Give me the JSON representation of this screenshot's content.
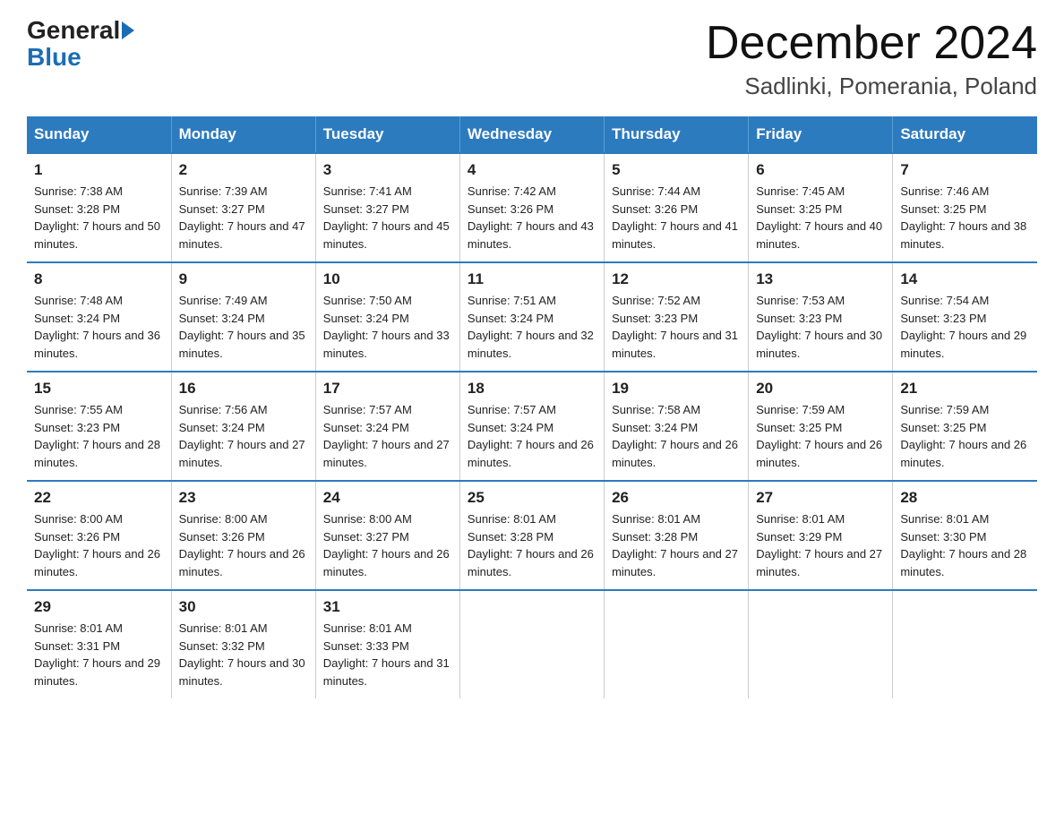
{
  "header": {
    "logo_general": "General",
    "logo_blue": "Blue",
    "month": "December 2024",
    "location": "Sadlinki, Pomerania, Poland"
  },
  "days_of_week": [
    "Sunday",
    "Monday",
    "Tuesday",
    "Wednesday",
    "Thursday",
    "Friday",
    "Saturday"
  ],
  "weeks": [
    [
      {
        "day": "1",
        "sunrise": "7:38 AM",
        "sunset": "3:28 PM",
        "daylight": "7 hours and 50 minutes."
      },
      {
        "day": "2",
        "sunrise": "7:39 AM",
        "sunset": "3:27 PM",
        "daylight": "7 hours and 47 minutes."
      },
      {
        "day": "3",
        "sunrise": "7:41 AM",
        "sunset": "3:27 PM",
        "daylight": "7 hours and 45 minutes."
      },
      {
        "day": "4",
        "sunrise": "7:42 AM",
        "sunset": "3:26 PM",
        "daylight": "7 hours and 43 minutes."
      },
      {
        "day": "5",
        "sunrise": "7:44 AM",
        "sunset": "3:26 PM",
        "daylight": "7 hours and 41 minutes."
      },
      {
        "day": "6",
        "sunrise": "7:45 AM",
        "sunset": "3:25 PM",
        "daylight": "7 hours and 40 minutes."
      },
      {
        "day": "7",
        "sunrise": "7:46 AM",
        "sunset": "3:25 PM",
        "daylight": "7 hours and 38 minutes."
      }
    ],
    [
      {
        "day": "8",
        "sunrise": "7:48 AM",
        "sunset": "3:24 PM",
        "daylight": "7 hours and 36 minutes."
      },
      {
        "day": "9",
        "sunrise": "7:49 AM",
        "sunset": "3:24 PM",
        "daylight": "7 hours and 35 minutes."
      },
      {
        "day": "10",
        "sunrise": "7:50 AM",
        "sunset": "3:24 PM",
        "daylight": "7 hours and 33 minutes."
      },
      {
        "day": "11",
        "sunrise": "7:51 AM",
        "sunset": "3:24 PM",
        "daylight": "7 hours and 32 minutes."
      },
      {
        "day": "12",
        "sunrise": "7:52 AM",
        "sunset": "3:23 PM",
        "daylight": "7 hours and 31 minutes."
      },
      {
        "day": "13",
        "sunrise": "7:53 AM",
        "sunset": "3:23 PM",
        "daylight": "7 hours and 30 minutes."
      },
      {
        "day": "14",
        "sunrise": "7:54 AM",
        "sunset": "3:23 PM",
        "daylight": "7 hours and 29 minutes."
      }
    ],
    [
      {
        "day": "15",
        "sunrise": "7:55 AM",
        "sunset": "3:23 PM",
        "daylight": "7 hours and 28 minutes."
      },
      {
        "day": "16",
        "sunrise": "7:56 AM",
        "sunset": "3:24 PM",
        "daylight": "7 hours and 27 minutes."
      },
      {
        "day": "17",
        "sunrise": "7:57 AM",
        "sunset": "3:24 PM",
        "daylight": "7 hours and 27 minutes."
      },
      {
        "day": "18",
        "sunrise": "7:57 AM",
        "sunset": "3:24 PM",
        "daylight": "7 hours and 26 minutes."
      },
      {
        "day": "19",
        "sunrise": "7:58 AM",
        "sunset": "3:24 PM",
        "daylight": "7 hours and 26 minutes."
      },
      {
        "day": "20",
        "sunrise": "7:59 AM",
        "sunset": "3:25 PM",
        "daylight": "7 hours and 26 minutes."
      },
      {
        "day": "21",
        "sunrise": "7:59 AM",
        "sunset": "3:25 PM",
        "daylight": "7 hours and 26 minutes."
      }
    ],
    [
      {
        "day": "22",
        "sunrise": "8:00 AM",
        "sunset": "3:26 PM",
        "daylight": "7 hours and 26 minutes."
      },
      {
        "day": "23",
        "sunrise": "8:00 AM",
        "sunset": "3:26 PM",
        "daylight": "7 hours and 26 minutes."
      },
      {
        "day": "24",
        "sunrise": "8:00 AM",
        "sunset": "3:27 PM",
        "daylight": "7 hours and 26 minutes."
      },
      {
        "day": "25",
        "sunrise": "8:01 AM",
        "sunset": "3:28 PM",
        "daylight": "7 hours and 26 minutes."
      },
      {
        "day": "26",
        "sunrise": "8:01 AM",
        "sunset": "3:28 PM",
        "daylight": "7 hours and 27 minutes."
      },
      {
        "day": "27",
        "sunrise": "8:01 AM",
        "sunset": "3:29 PM",
        "daylight": "7 hours and 27 minutes."
      },
      {
        "day": "28",
        "sunrise": "8:01 AM",
        "sunset": "3:30 PM",
        "daylight": "7 hours and 28 minutes."
      }
    ],
    [
      {
        "day": "29",
        "sunrise": "8:01 AM",
        "sunset": "3:31 PM",
        "daylight": "7 hours and 29 minutes."
      },
      {
        "day": "30",
        "sunrise": "8:01 AM",
        "sunset": "3:32 PM",
        "daylight": "7 hours and 30 minutes."
      },
      {
        "day": "31",
        "sunrise": "8:01 AM",
        "sunset": "3:33 PM",
        "daylight": "7 hours and 31 minutes."
      },
      null,
      null,
      null,
      null
    ]
  ]
}
